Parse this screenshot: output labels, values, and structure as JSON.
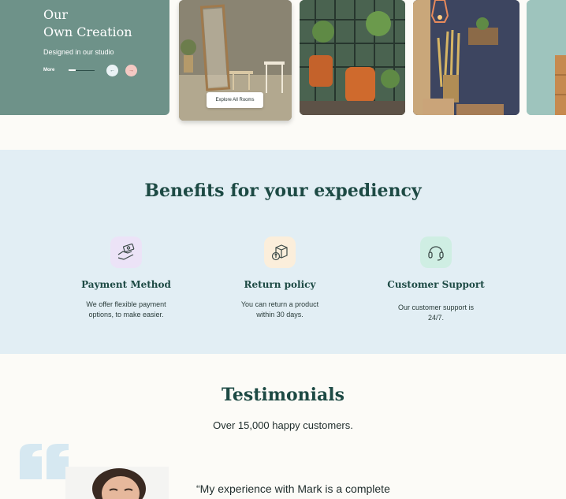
{
  "hero": {
    "title_line1": "Our",
    "title_line2": "Own Creation",
    "subtitle": "Designed in our studio",
    "more_label": "More",
    "prev_icon": "←",
    "next_icon": "→"
  },
  "gallery": {
    "explore_label": "Explore All Rooms"
  },
  "benefits": {
    "title": "Benefits for your expediency",
    "items": [
      {
        "icon": "hand-money-icon",
        "title": "Payment Method",
        "desc": "We offer flexible payment options, to make easier."
      },
      {
        "icon": "return-box-icon",
        "title": "Return policy",
        "desc": "You can return a product within 30 days."
      },
      {
        "icon": "headset-icon",
        "title": "Customer Support",
        "desc": "Our customer support is 24/7."
      }
    ]
  },
  "testimonials": {
    "title": "Testimonials",
    "subtitle": "Over 15,000 happy customers.",
    "quote": "“My experience with Mark is a complete"
  },
  "colors": {
    "brand_green": "#1d4a44",
    "hero_bg": "#6e9289",
    "benefits_bg": "#e2eef4"
  }
}
